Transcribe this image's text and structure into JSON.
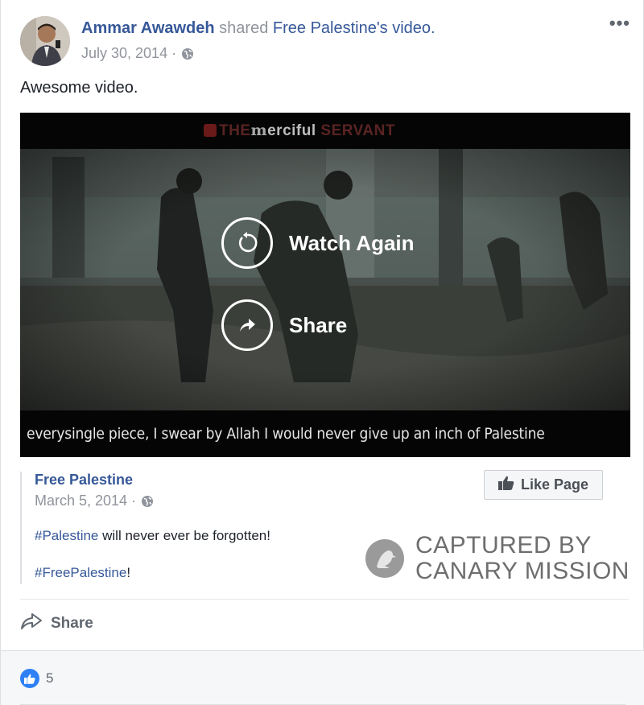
{
  "post": {
    "author": "Ammar Awawdeh",
    "action": "shared",
    "shared_page": "Free Palestine",
    "shared_suffix": "'s video.",
    "date": "July 30, 2014 ·",
    "status": "Awesome video.",
    "more_label": "•••"
  },
  "video": {
    "channel_pre": "THE",
    "channel_m": "m",
    "channel_main": "erciful",
    "channel_post": "SERVANT",
    "subtitle": "everysingle piece, I swear by Allah I would never give up an inch of Palestine",
    "watch_again": "Watch Again",
    "share": "Share"
  },
  "attachment": {
    "page_name": "Free Palestine",
    "date": "March 5, 2014 ·",
    "like_page": "Like Page",
    "line1_tag": "#Palestine",
    "line1_rest": " will never ever be forgotten!",
    "line2_tag": "#FreePalestine",
    "line2_rest": "!"
  },
  "watermark": {
    "line1": "CAPTURED BY",
    "line2": "CANARY MISSION"
  },
  "actions": {
    "share": "Share"
  },
  "reactions": {
    "count": "5"
  },
  "colors": {
    "link": "#365899",
    "meta": "#90949c",
    "like_blue": "#2e81f4"
  }
}
